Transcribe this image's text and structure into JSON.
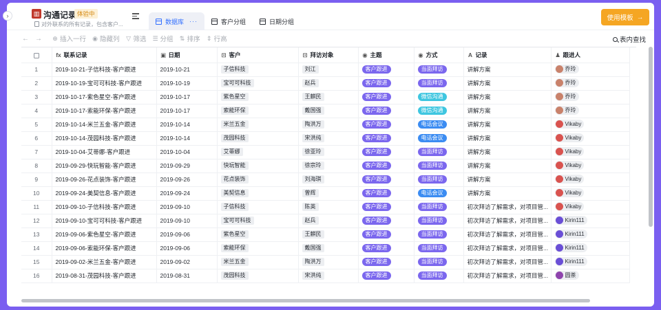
{
  "app": {
    "title": "沟通记录",
    "badge": "体验中",
    "subtitle": "对外联系的所有记录，包含客户...",
    "logo_icon": "ribbon-logo-icon"
  },
  "tabs": [
    {
      "label": "数据库",
      "active": true,
      "more": "···"
    },
    {
      "label": "客户分组",
      "active": false
    },
    {
      "label": "日期分组",
      "active": false
    }
  ],
  "use_template": {
    "label": "使用模板",
    "arrow": "→",
    "color": "#f5a623"
  },
  "toolbar": {
    "undo": "←",
    "redo": "→",
    "insert": "插入一行",
    "hide": "隐藏列",
    "filter": "筛选",
    "group": "分组",
    "sort": "排序",
    "row_height": "行高",
    "find": "表内查找"
  },
  "columns": [
    {
      "label": "联系记录",
      "icon": "fx"
    },
    {
      "label": "日期",
      "icon": "▣"
    },
    {
      "label": "客户",
      "icon": "⊡"
    },
    {
      "label": "拜访对象",
      "icon": "⊡"
    },
    {
      "label": "主题",
      "icon": "◉"
    },
    {
      "label": "方式",
      "icon": "◉"
    },
    {
      "label": "记录",
      "icon": "A"
    },
    {
      "label": "跟进人",
      "icon": "♟"
    }
  ],
  "colors": {
    "topic": "#7b67ee",
    "visit": "#7b67ee",
    "wechat": "#3ec6e0",
    "meeting": "#3b8cf2",
    "accent": "#3370ff"
  },
  "rows": [
    {
      "idx": "1",
      "record": "2019-10-21-子信科技-客户跟进",
      "date": "2019-10-21",
      "client": "子信科技",
      "contact": "刘江",
      "topic": "客户跟进",
      "method": "当面拜访",
      "method_type": "visit",
      "note": "讲解方案",
      "person": "乔玲",
      "avatar": "#c9826b"
    },
    {
      "idx": "2",
      "record": "2019-10-19-宝可可科技-客户跟进",
      "date": "2019-10-19",
      "client": "宝可可科技",
      "contact": "赵兵",
      "topic": "客户跟进",
      "method": "当面拜访",
      "method_type": "visit",
      "note": "讲解方案",
      "person": "乔玲",
      "avatar": "#c9826b"
    },
    {
      "idx": "3",
      "record": "2019-10-17-紫色星空-客户跟进",
      "date": "2019-10-17",
      "client": "紫色星空",
      "contact": "王麒民",
      "topic": "客户跟进",
      "method": "微信沟通",
      "method_type": "wx",
      "note": "讲解方案",
      "person": "乔玲",
      "avatar": "#c9826b"
    },
    {
      "idx": "4",
      "record": "2019-10-17-索能环保-客户跟进",
      "date": "2019-10-17",
      "client": "索能环保",
      "contact": "戴国强",
      "topic": "客户跟进",
      "method": "微信沟通",
      "method_type": "wx",
      "note": "讲解方案",
      "person": "乔玲",
      "avatar": "#c9826b"
    },
    {
      "idx": "5",
      "record": "2019-10-14-米兰五金-客户跟进",
      "date": "2019-10-14",
      "client": "米兰五金",
      "contact": "陶洪万",
      "topic": "客户跟进",
      "method": "电话会议",
      "method_type": "meet",
      "note": "讲解方案",
      "person": "Vikaby",
      "avatar": "#d9534f"
    },
    {
      "idx": "6",
      "record": "2019-10-14-茂园科技-客户跟进",
      "date": "2019-10-14",
      "client": "茂园科技",
      "contact": "宋洪纯",
      "topic": "客户跟进",
      "method": "电话会议",
      "method_type": "meet",
      "note": "讲解方案",
      "person": "Vikaby",
      "avatar": "#d9534f"
    },
    {
      "idx": "7",
      "record": "2019-10-04-艾蒂娜-客户跟进",
      "date": "2019-10-04",
      "client": "艾蒂娜",
      "contact": "徐亚玲",
      "topic": "客户跟进",
      "method": "当面拜访",
      "method_type": "visit",
      "note": "讲解方案",
      "person": "Vikaby",
      "avatar": "#d9534f"
    },
    {
      "idx": "8",
      "record": "2019-09-29-快玩智能-客户跟进",
      "date": "2019-09-29",
      "client": "快玩智能",
      "contact": "徐宗玲",
      "topic": "客户跟进",
      "method": "当面拜访",
      "method_type": "visit",
      "note": "讲解方案",
      "person": "Vikaby",
      "avatar": "#d9534f"
    },
    {
      "idx": "9",
      "record": "2019-09-26-花点装饰-客户跟进",
      "date": "2019-09-26",
      "client": "花点装饰",
      "contact": "刘海琪",
      "topic": "客户跟进",
      "method": "当面拜访",
      "method_type": "visit",
      "note": "讲解方案",
      "person": "Vikaby",
      "avatar": "#d9534f"
    },
    {
      "idx": "10",
      "record": "2019-09-24-美契信息-客户跟进",
      "date": "2019-09-24",
      "client": "美契信息",
      "contact": "曾辉",
      "topic": "客户跟进",
      "method": "电话会议",
      "method_type": "meet",
      "note": "讲解方案",
      "person": "Vikaby",
      "avatar": "#d9534f"
    },
    {
      "idx": "11",
      "record": "2019-09-10-子信科技-客户跟进",
      "date": "2019-09-10",
      "client": "子信科技",
      "contact": "陈英",
      "topic": "客户跟进",
      "method": "当面拜访",
      "method_type": "visit",
      "note": "初次拜访了解需求，对项目管...",
      "person": "Vikaby",
      "avatar": "#d9534f"
    },
    {
      "idx": "12",
      "record": "2019-09-10-宝可可科技-客户跟进",
      "date": "2019-09-10",
      "client": "宝可可科技",
      "contact": "赵兵",
      "topic": "客户跟进",
      "method": "当面拜访",
      "method_type": "visit",
      "note": "初次拜访了解需求，对项目管...",
      "person": "Kirin111",
      "avatar": "#6a4fd6"
    },
    {
      "idx": "13",
      "record": "2019-09-06-紫色星空-客户跟进",
      "date": "2019-09-06",
      "client": "紫色星空",
      "contact": "王麒民",
      "topic": "客户跟进",
      "method": "当面拜访",
      "method_type": "visit",
      "note": "初次拜访了解需求，对项目管...",
      "person": "Kirin111",
      "avatar": "#6a4fd6"
    },
    {
      "idx": "14",
      "record": "2019-09-06-索能环保-客户跟进",
      "date": "2019-09-06",
      "client": "索能环保",
      "contact": "戴国强",
      "topic": "客户跟进",
      "method": "当面拜访",
      "method_type": "visit",
      "note": "初次拜访了解需求，对项目管...",
      "person": "Kirin111",
      "avatar": "#6a4fd6"
    },
    {
      "idx": "15",
      "record": "2019-09-02-米兰五金-客户跟进",
      "date": "2019-09-02",
      "client": "米兰五金",
      "contact": "陶洪万",
      "topic": "客户跟进",
      "method": "当面拜访",
      "method_type": "visit",
      "note": "初次拜访了解需求，对项目管...",
      "person": "Kirin111",
      "avatar": "#6a4fd6"
    },
    {
      "idx": "16",
      "record": "2019-08-31-茂园科技-客户跟进",
      "date": "2019-08-31",
      "client": "茂园科技",
      "contact": "宋洪纯",
      "topic": "客户跟进",
      "method": "当面拜访",
      "method_type": "visit",
      "note": "初次拜访了解需求，对项目管...",
      "person": "圆茶",
      "avatar": "#8e44ad"
    }
  ]
}
